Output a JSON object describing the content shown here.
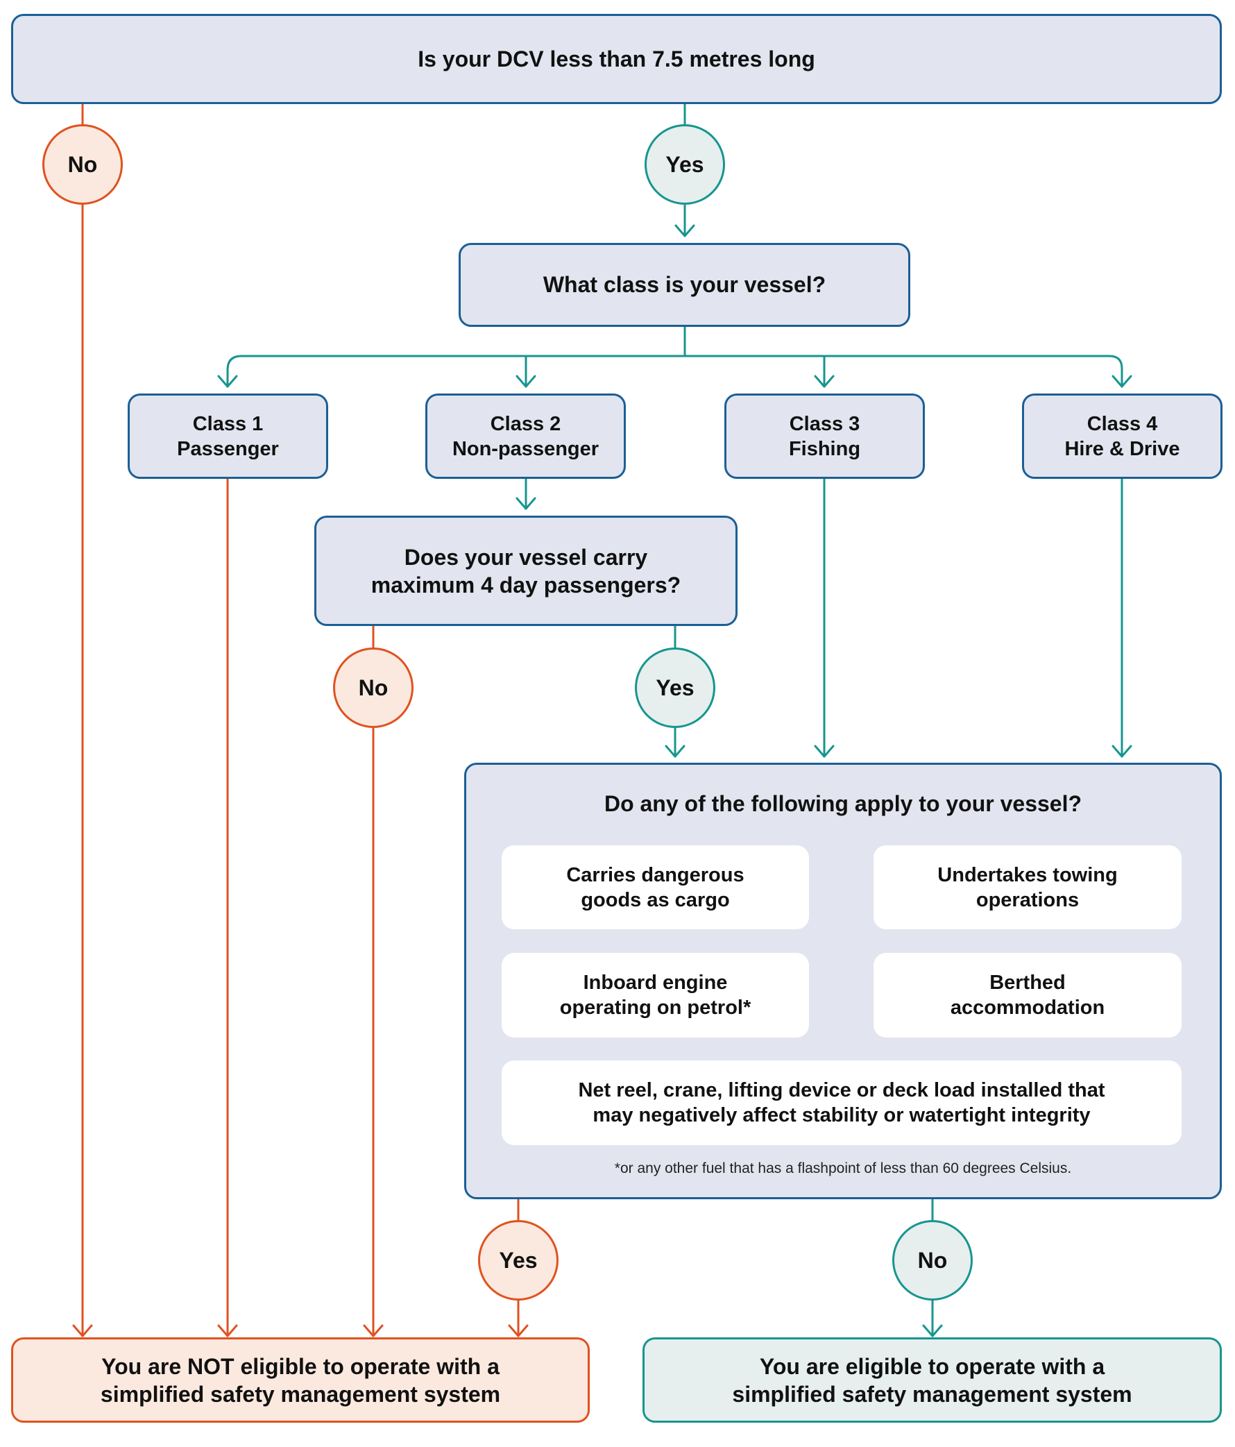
{
  "colors": {
    "negative": "#e0521f",
    "positive": "#17958f",
    "box_border": "#1b5f96",
    "box_fill": "#e2e5ef"
  },
  "question_length": "Is your DCV less than 7.5 metres long",
  "question_length_no": "No",
  "question_length_yes": "Yes",
  "question_class": "What class is your vessel?",
  "classes": [
    {
      "line1": "Class 1",
      "line2": "Passenger"
    },
    {
      "line1": "Class 2",
      "line2": "Non-passenger"
    },
    {
      "line1": "Class 3",
      "line2": "Fishing"
    },
    {
      "line1": "Class 4",
      "line2": "Hire & Drive"
    }
  ],
  "question_passengers": {
    "line1": "Does your vessel carry",
    "line2": "maximum 4 day passengers?"
  },
  "question_passengers_no": "No",
  "question_passengers_yes": "Yes",
  "conditions": {
    "title": "Do any of the following apply to your vessel?",
    "items": [
      {
        "line1": "Carries dangerous",
        "line2": "goods as cargo"
      },
      {
        "line1": "Undertakes towing",
        "line2": "operations"
      },
      {
        "line1": "Inboard engine",
        "line2": "operating on petrol*"
      },
      {
        "line1": "Berthed",
        "line2": "accommodation"
      },
      {
        "line1": "Net reel, crane, lifting device or deck load installed that",
        "line2": "may negatively affect stability or watertight integrity"
      }
    ],
    "footnote": "*or any other fuel that has a flashpoint of less than 60 degrees Celsius."
  },
  "conditions_yes": "Yes",
  "conditions_no": "No",
  "result_not_eligible": {
    "line1": "You are NOT eligible to operate with a",
    "line2": "simplified safety management system"
  },
  "result_eligible": {
    "line1": "You are eligible to operate with a",
    "line2": "simplified safety management system"
  }
}
